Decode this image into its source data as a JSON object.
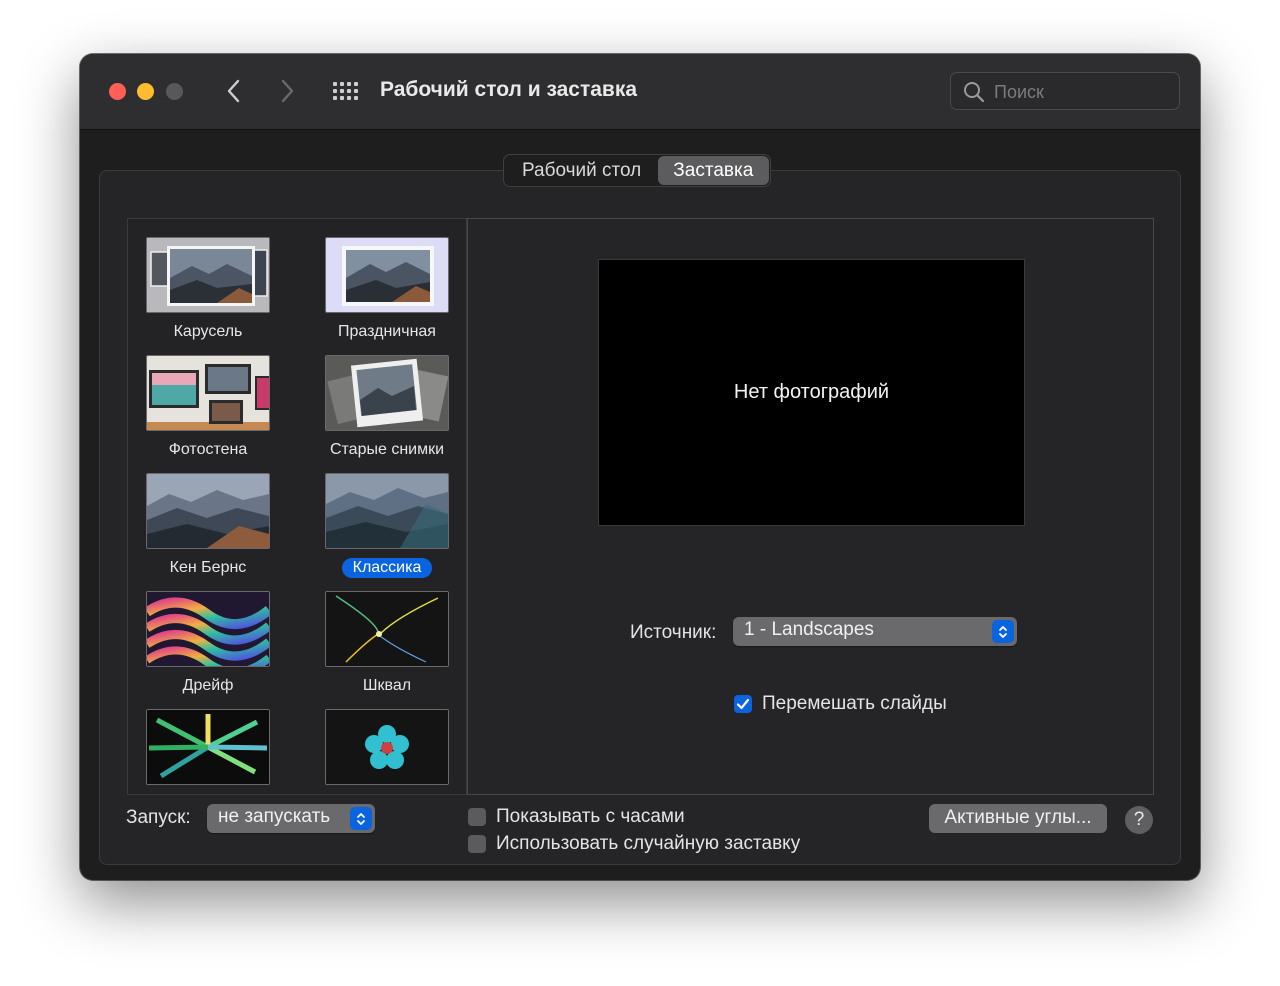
{
  "window": {
    "title": "Рабочий стол и заставка",
    "search_placeholder": "Поиск"
  },
  "tabs": [
    {
      "label": "Рабочий стол",
      "active": false
    },
    {
      "label": "Заставка",
      "active": true
    }
  ],
  "screensavers": [
    {
      "label": "Карусель",
      "selected": false
    },
    {
      "label": "Праздничная",
      "selected": false
    },
    {
      "label": "Фотостена",
      "selected": false
    },
    {
      "label": "Старые снимки",
      "selected": false
    },
    {
      "label": "Кен Бернс",
      "selected": false
    },
    {
      "label": "Классика",
      "selected": true
    },
    {
      "label": "Дрейф",
      "selected": false
    },
    {
      "label": "Шквал",
      "selected": false
    }
  ],
  "preview": {
    "message": "Нет фотографий",
    "source_label": "Источник:",
    "source_value": "1 - Landscapes",
    "shuffle_label": "Перемешать слайды",
    "shuffle_checked": true
  },
  "footer": {
    "start_label": "Запуск:",
    "start_value": "не запускать",
    "show_clock_label": "Показывать с часами",
    "show_clock_checked": false,
    "random_label": "Использовать случайную заставку",
    "random_checked": false,
    "hot_corners_label": "Активные углы...",
    "help_label": "?"
  },
  "colors": {
    "accent": "#0a64e0",
    "close": "#ff5f57",
    "minimize": "#febc2e",
    "zoom_disabled": "#58585a"
  }
}
